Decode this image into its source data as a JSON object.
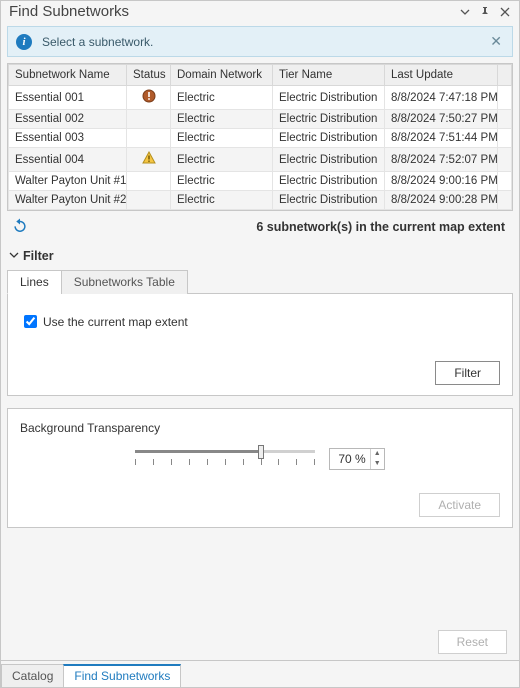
{
  "title": "Find Subnetworks",
  "info_message": "Select a subnetwork.",
  "columns": [
    "Subnetwork Name",
    "Status",
    "Domain Network",
    "Tier Name",
    "Last Update"
  ],
  "rows": [
    {
      "name": "Essential 001",
      "status": "alert",
      "domain": "Electric",
      "tier": "Electric Distribution",
      "updated": "8/8/2024 7:47:18 PM"
    },
    {
      "name": "Essential 002",
      "status": "",
      "domain": "Electric",
      "tier": "Electric Distribution",
      "updated": "8/8/2024 7:50:27 PM"
    },
    {
      "name": "Essential 003",
      "status": "",
      "domain": "Electric",
      "tier": "Electric Distribution",
      "updated": "8/8/2024 7:51:44 PM"
    },
    {
      "name": "Essential 004",
      "status": "warn",
      "domain": "Electric",
      "tier": "Electric Distribution",
      "updated": "8/8/2024 7:52:07 PM"
    },
    {
      "name": "Walter Payton Unit #1",
      "status": "",
      "domain": "Electric",
      "tier": "Electric Distribution",
      "updated": "8/8/2024 9:00:16 PM"
    },
    {
      "name": "Walter Payton Unit #2",
      "status": "",
      "domain": "Electric",
      "tier": "Electric Distribution",
      "updated": "8/8/2024 9:00:28 PM"
    }
  ],
  "summary": "6 subnetwork(s) in the current map extent",
  "filter": {
    "header": "Filter",
    "tabs": {
      "lines": "Lines",
      "subnetworks_table": "Subnetworks Table"
    },
    "use_extent_label": "Use the current map extent",
    "use_extent_checked": true,
    "filter_button": "Filter"
  },
  "bg": {
    "label": "Background Transparency",
    "percent": 70,
    "display": "70 %",
    "activate_button": "Activate"
  },
  "reset_button": "Reset",
  "bottom_tabs": {
    "catalog": "Catalog",
    "find": "Find Subnetworks"
  }
}
